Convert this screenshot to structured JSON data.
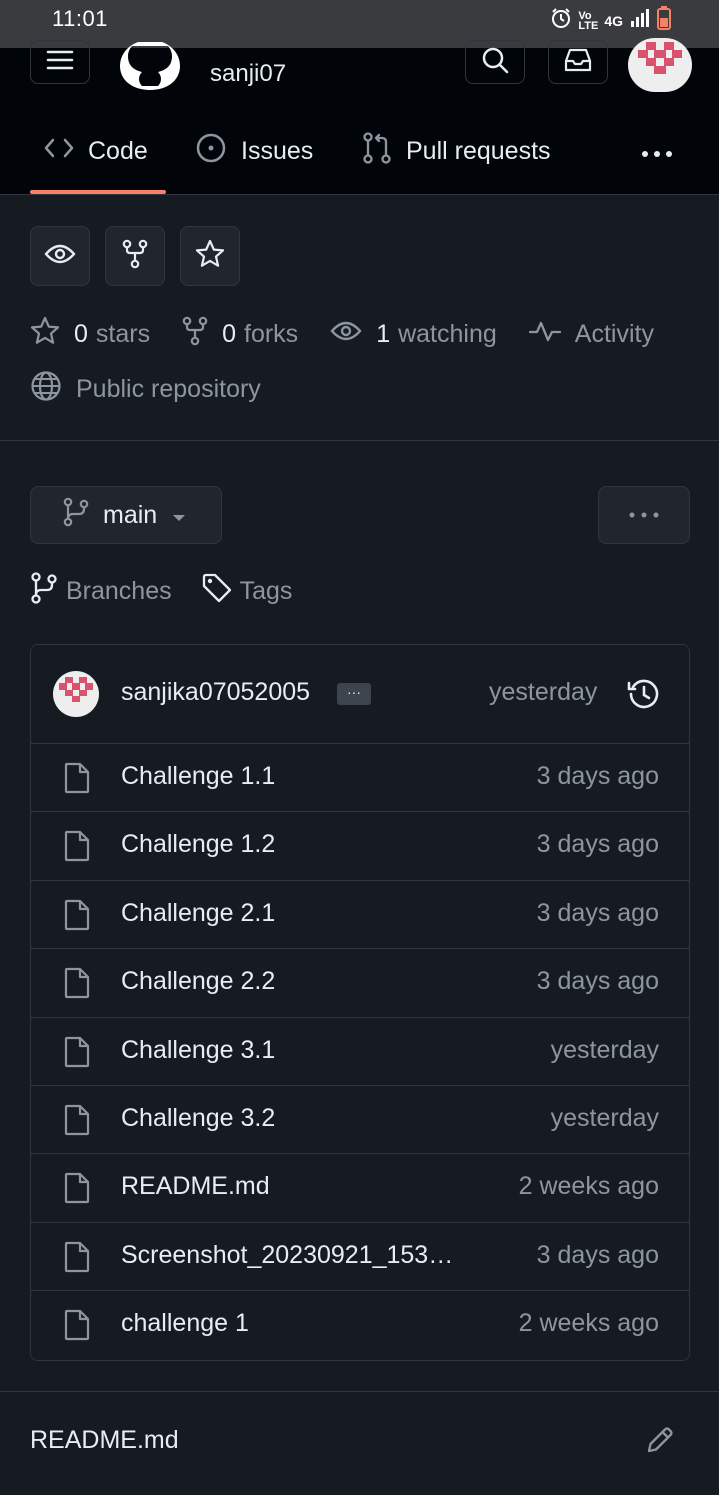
{
  "status_bar": {
    "time": "11:01",
    "network": "4G"
  },
  "header": {
    "repo_name": "sanji07",
    "icons": [
      "menu-icon",
      "github-logo",
      "search-icon",
      "inbox-icon",
      "avatar"
    ]
  },
  "tabs": [
    {
      "label": "Code",
      "icon": "code-icon",
      "active": true
    },
    {
      "label": "Issues",
      "icon": "issue-icon"
    },
    {
      "label": "Pull requests",
      "icon": "pull-request-icon"
    }
  ],
  "stats": {
    "stars": {
      "count": "0",
      "label": "stars"
    },
    "forks": {
      "count": "0",
      "label": "forks"
    },
    "watching": {
      "count": "1",
      "label": "watching"
    },
    "activity": "Activity",
    "visibility": "Public repository"
  },
  "branch": {
    "name": "main",
    "branches_label": "Branches",
    "tags_label": "Tags"
  },
  "latest_commit": {
    "author": "sanjika07052005",
    "ellipsis": "···",
    "time": "yesterday"
  },
  "files": [
    {
      "name": "Challenge 1.1",
      "time": "3 days ago"
    },
    {
      "name": "Challenge 1.2",
      "time": "3 days ago"
    },
    {
      "name": "Challenge 2.1",
      "time": "3 days ago"
    },
    {
      "name": "Challenge 2.2",
      "time": "3 days ago"
    },
    {
      "name": "Challenge 3.1",
      "time": "yesterday"
    },
    {
      "name": "Challenge 3.2",
      "time": "yesterday"
    },
    {
      "name": "README.md",
      "time": "2 weeks ago"
    },
    {
      "name": "Screenshot_20230921_153…",
      "time": "3 days ago"
    },
    {
      "name": "challenge 1",
      "time": "2 weeks ago"
    }
  ],
  "readme": {
    "title": "README.md"
  },
  "colors": {
    "background": "#161b22",
    "header": "#010409",
    "accent_underline": "#f78166",
    "muted_text": "#8d96a0"
  }
}
